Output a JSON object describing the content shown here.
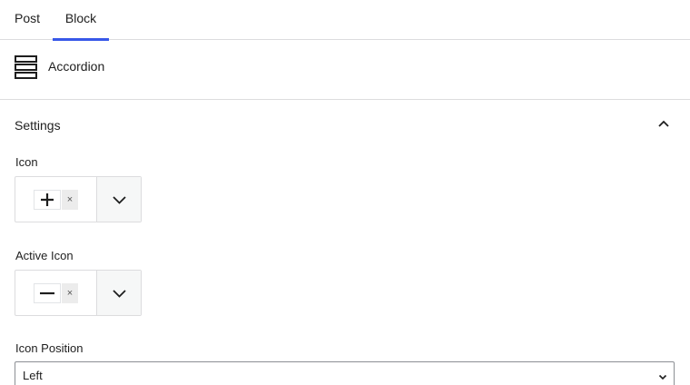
{
  "tabs": [
    {
      "label": "Post"
    },
    {
      "label": "Block"
    }
  ],
  "block": {
    "title": "Accordion",
    "icon": "accordion-icon"
  },
  "settings": {
    "title": "Settings",
    "icon_label": "Icon",
    "icon_value": "plus-icon",
    "icon_remove": "×",
    "active_icon_label": "Active Icon",
    "active_icon_value": "minus-icon",
    "active_icon_remove": "×",
    "position_label": "Icon Position",
    "position_value": "Left"
  },
  "colors": {
    "accent": "#3858e9",
    "border": "#dcdcde"
  }
}
